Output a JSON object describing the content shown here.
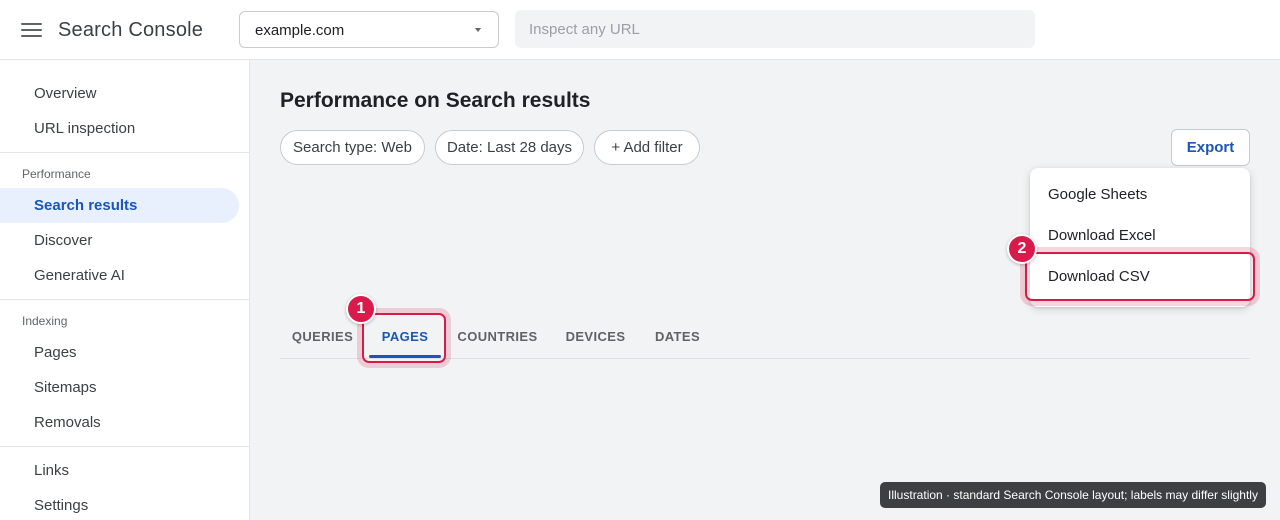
{
  "header": {
    "app_title": "Search Console",
    "property_value": "example.com",
    "inspect_placeholder": "Inspect any URL"
  },
  "sidebar": {
    "top_items": [
      {
        "label": "Overview"
      },
      {
        "label": "URL inspection"
      }
    ],
    "performance": {
      "heading": "Performance",
      "items": [
        {
          "label": "Search results",
          "active": true
        },
        {
          "label": "Discover"
        },
        {
          "label": "Generative AI"
        }
      ]
    },
    "indexing": {
      "heading": "Indexing",
      "items": [
        {
          "label": "Pages"
        },
        {
          "label": "Sitemaps"
        },
        {
          "label": "Removals"
        }
      ]
    },
    "bottom_items": [
      {
        "label": "Links"
      },
      {
        "label": "Settings"
      }
    ]
  },
  "main": {
    "title": "Performance on Search results",
    "filters": [
      {
        "label": "Search type: Web"
      },
      {
        "label": "Date: Last 28 days"
      },
      {
        "label": "+ Add filter"
      }
    ],
    "export_label": "Export",
    "export_menu": [
      {
        "label": "Google Sheets"
      },
      {
        "label": "Download Excel"
      },
      {
        "label": "Download CSV",
        "highlighted": true
      }
    ],
    "tabs": [
      {
        "label": "QUERIES"
      },
      {
        "label": "PAGES",
        "active": true
      },
      {
        "label": "COUNTRIES"
      },
      {
        "label": "DEVICES"
      },
      {
        "label": "DATES"
      }
    ]
  },
  "annotations": {
    "steps": [
      "1",
      "2"
    ],
    "highlight_color": "#d81b4a",
    "caption": "Illustration · standard Search Console layout; labels may differ slightly"
  },
  "colors": {
    "accent": "#1a56b8",
    "active_nav_bg": "#e8f0fe",
    "page_bg": "#f1f3f4"
  }
}
